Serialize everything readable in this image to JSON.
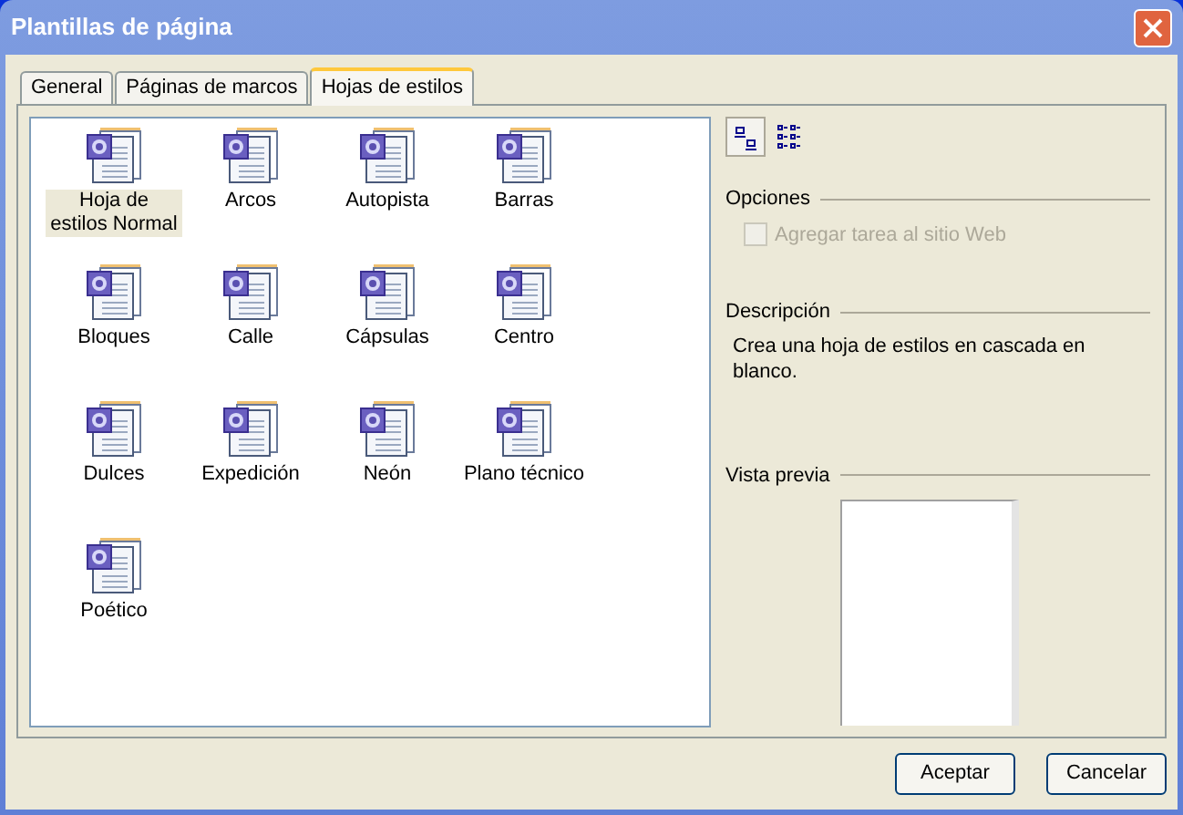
{
  "window": {
    "title": "Plantillas de página"
  },
  "tabs": [
    {
      "label": "General",
      "selected": false
    },
    {
      "label": "Páginas de marcos",
      "selected": false
    },
    {
      "label": "Hojas de estilos",
      "selected": true
    }
  ],
  "templates": [
    {
      "label": "Hoja de estilos Normal",
      "selected": true
    },
    {
      "label": "Arcos",
      "selected": false
    },
    {
      "label": "Autopista",
      "selected": false
    },
    {
      "label": "Barras",
      "selected": false
    },
    {
      "label": "Bloques",
      "selected": false
    },
    {
      "label": "Calle",
      "selected": false
    },
    {
      "label": "Cápsulas",
      "selected": false
    },
    {
      "label": "Centro",
      "selected": false
    },
    {
      "label": "Dulces",
      "selected": false
    },
    {
      "label": "Expedición",
      "selected": false
    },
    {
      "label": "Neón",
      "selected": false
    },
    {
      "label": "Plano técnico",
      "selected": false
    },
    {
      "label": "Poético",
      "selected": false
    }
  ],
  "view_modes": [
    {
      "kind": "large",
      "selected": true
    },
    {
      "kind": "list",
      "selected": false
    }
  ],
  "options": {
    "heading": "Opciones",
    "checkbox": {
      "label": "Agregar tarea al sitio Web",
      "checked": false,
      "disabled": true
    }
  },
  "description": {
    "heading": "Descripción",
    "text": "Crea una hoja de estilos en cascada en blanco."
  },
  "preview": {
    "heading": "Vista previa"
  },
  "buttons": [
    "Aceptar",
    "Cancelar"
  ]
}
